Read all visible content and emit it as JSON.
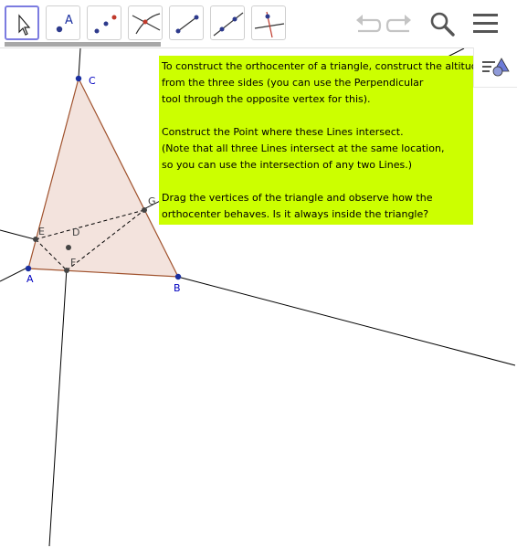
{
  "toolbar": {
    "tools": [
      {
        "name": "move-tool",
        "selected": true
      },
      {
        "name": "point-tool",
        "label": "A"
      },
      {
        "name": "point-on-object-tool"
      },
      {
        "name": "intersect-tool"
      },
      {
        "name": "segment-tool"
      },
      {
        "name": "line-tool"
      },
      {
        "name": "perpendicular-line-tool"
      }
    ],
    "icons": [
      "undo-icon",
      "redo-icon",
      "search-icon",
      "menu-icon"
    ]
  },
  "points": {
    "A": "A",
    "B": "B",
    "C": "C",
    "D": "D",
    "E": "E",
    "F": "F",
    "G": "G"
  },
  "instructions": {
    "line1": "To construct the orthocenter of a triangle, construct the altitudes",
    "line2": "from the three sides (you can use the Perpendicular",
    "line3": "tool through the opposite vertex for this).",
    "line4": "Construct the Point where these Lines intersect.",
    "line5": "(Note that all three Lines intersect at the same location,",
    "line6": "so you can use the intersection of any two Lines.)",
    "line7": "Drag the vertices of the triangle and observe how the",
    "line8": "orthocenter behaves. Is it always inside the triangle?"
  },
  "colors": {
    "accent": "#7c7ce0",
    "textbox_bg": "#ccff00",
    "triangle_fill": "#f3e3dd",
    "triangle_edge": "#a0522d",
    "point_label": "#0000c0"
  }
}
